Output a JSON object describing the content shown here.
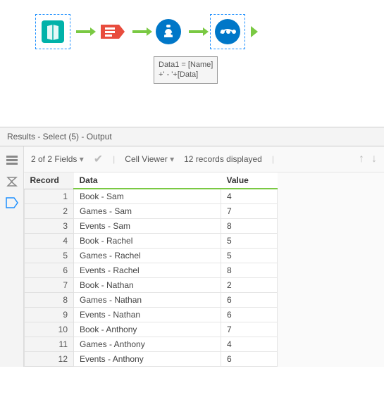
{
  "canvas": {
    "tools": [
      {
        "name": "input-data-tool",
        "selected": true
      },
      {
        "name": "select-tool",
        "selected": false
      },
      {
        "name": "formula-tool",
        "selected": false
      },
      {
        "name": "browse-tool",
        "selected": true
      }
    ],
    "tooltip": "Data1 = [Name]\n+' - '+[Data]"
  },
  "results": {
    "title": "Results - Select (5) - Output",
    "fields_label": "2 of 2 Fields",
    "cell_viewer_label": "Cell Viewer",
    "records_label": "12 records displayed",
    "columns": {
      "record": "Record",
      "data": "Data",
      "value": "Value"
    },
    "rows": [
      {
        "record": 1,
        "data": "Book - Sam",
        "value": 4
      },
      {
        "record": 2,
        "data": "Games - Sam",
        "value": 7
      },
      {
        "record": 3,
        "data": "Events - Sam",
        "value": 8
      },
      {
        "record": 4,
        "data": "Book - Rachel",
        "value": 5
      },
      {
        "record": 5,
        "data": "Games - Rachel",
        "value": 5
      },
      {
        "record": 6,
        "data": "Events - Rachel",
        "value": 8
      },
      {
        "record": 7,
        "data": "Book - Nathan",
        "value": 2
      },
      {
        "record": 8,
        "data": "Games - Nathan",
        "value": 6
      },
      {
        "record": 9,
        "data": "Events - Nathan",
        "value": 6
      },
      {
        "record": 10,
        "data": "Book - Anthony",
        "value": 7
      },
      {
        "record": 11,
        "data": "Games - Anthony",
        "value": 4
      },
      {
        "record": 12,
        "data": "Events - Anthony",
        "value": 6
      }
    ]
  }
}
